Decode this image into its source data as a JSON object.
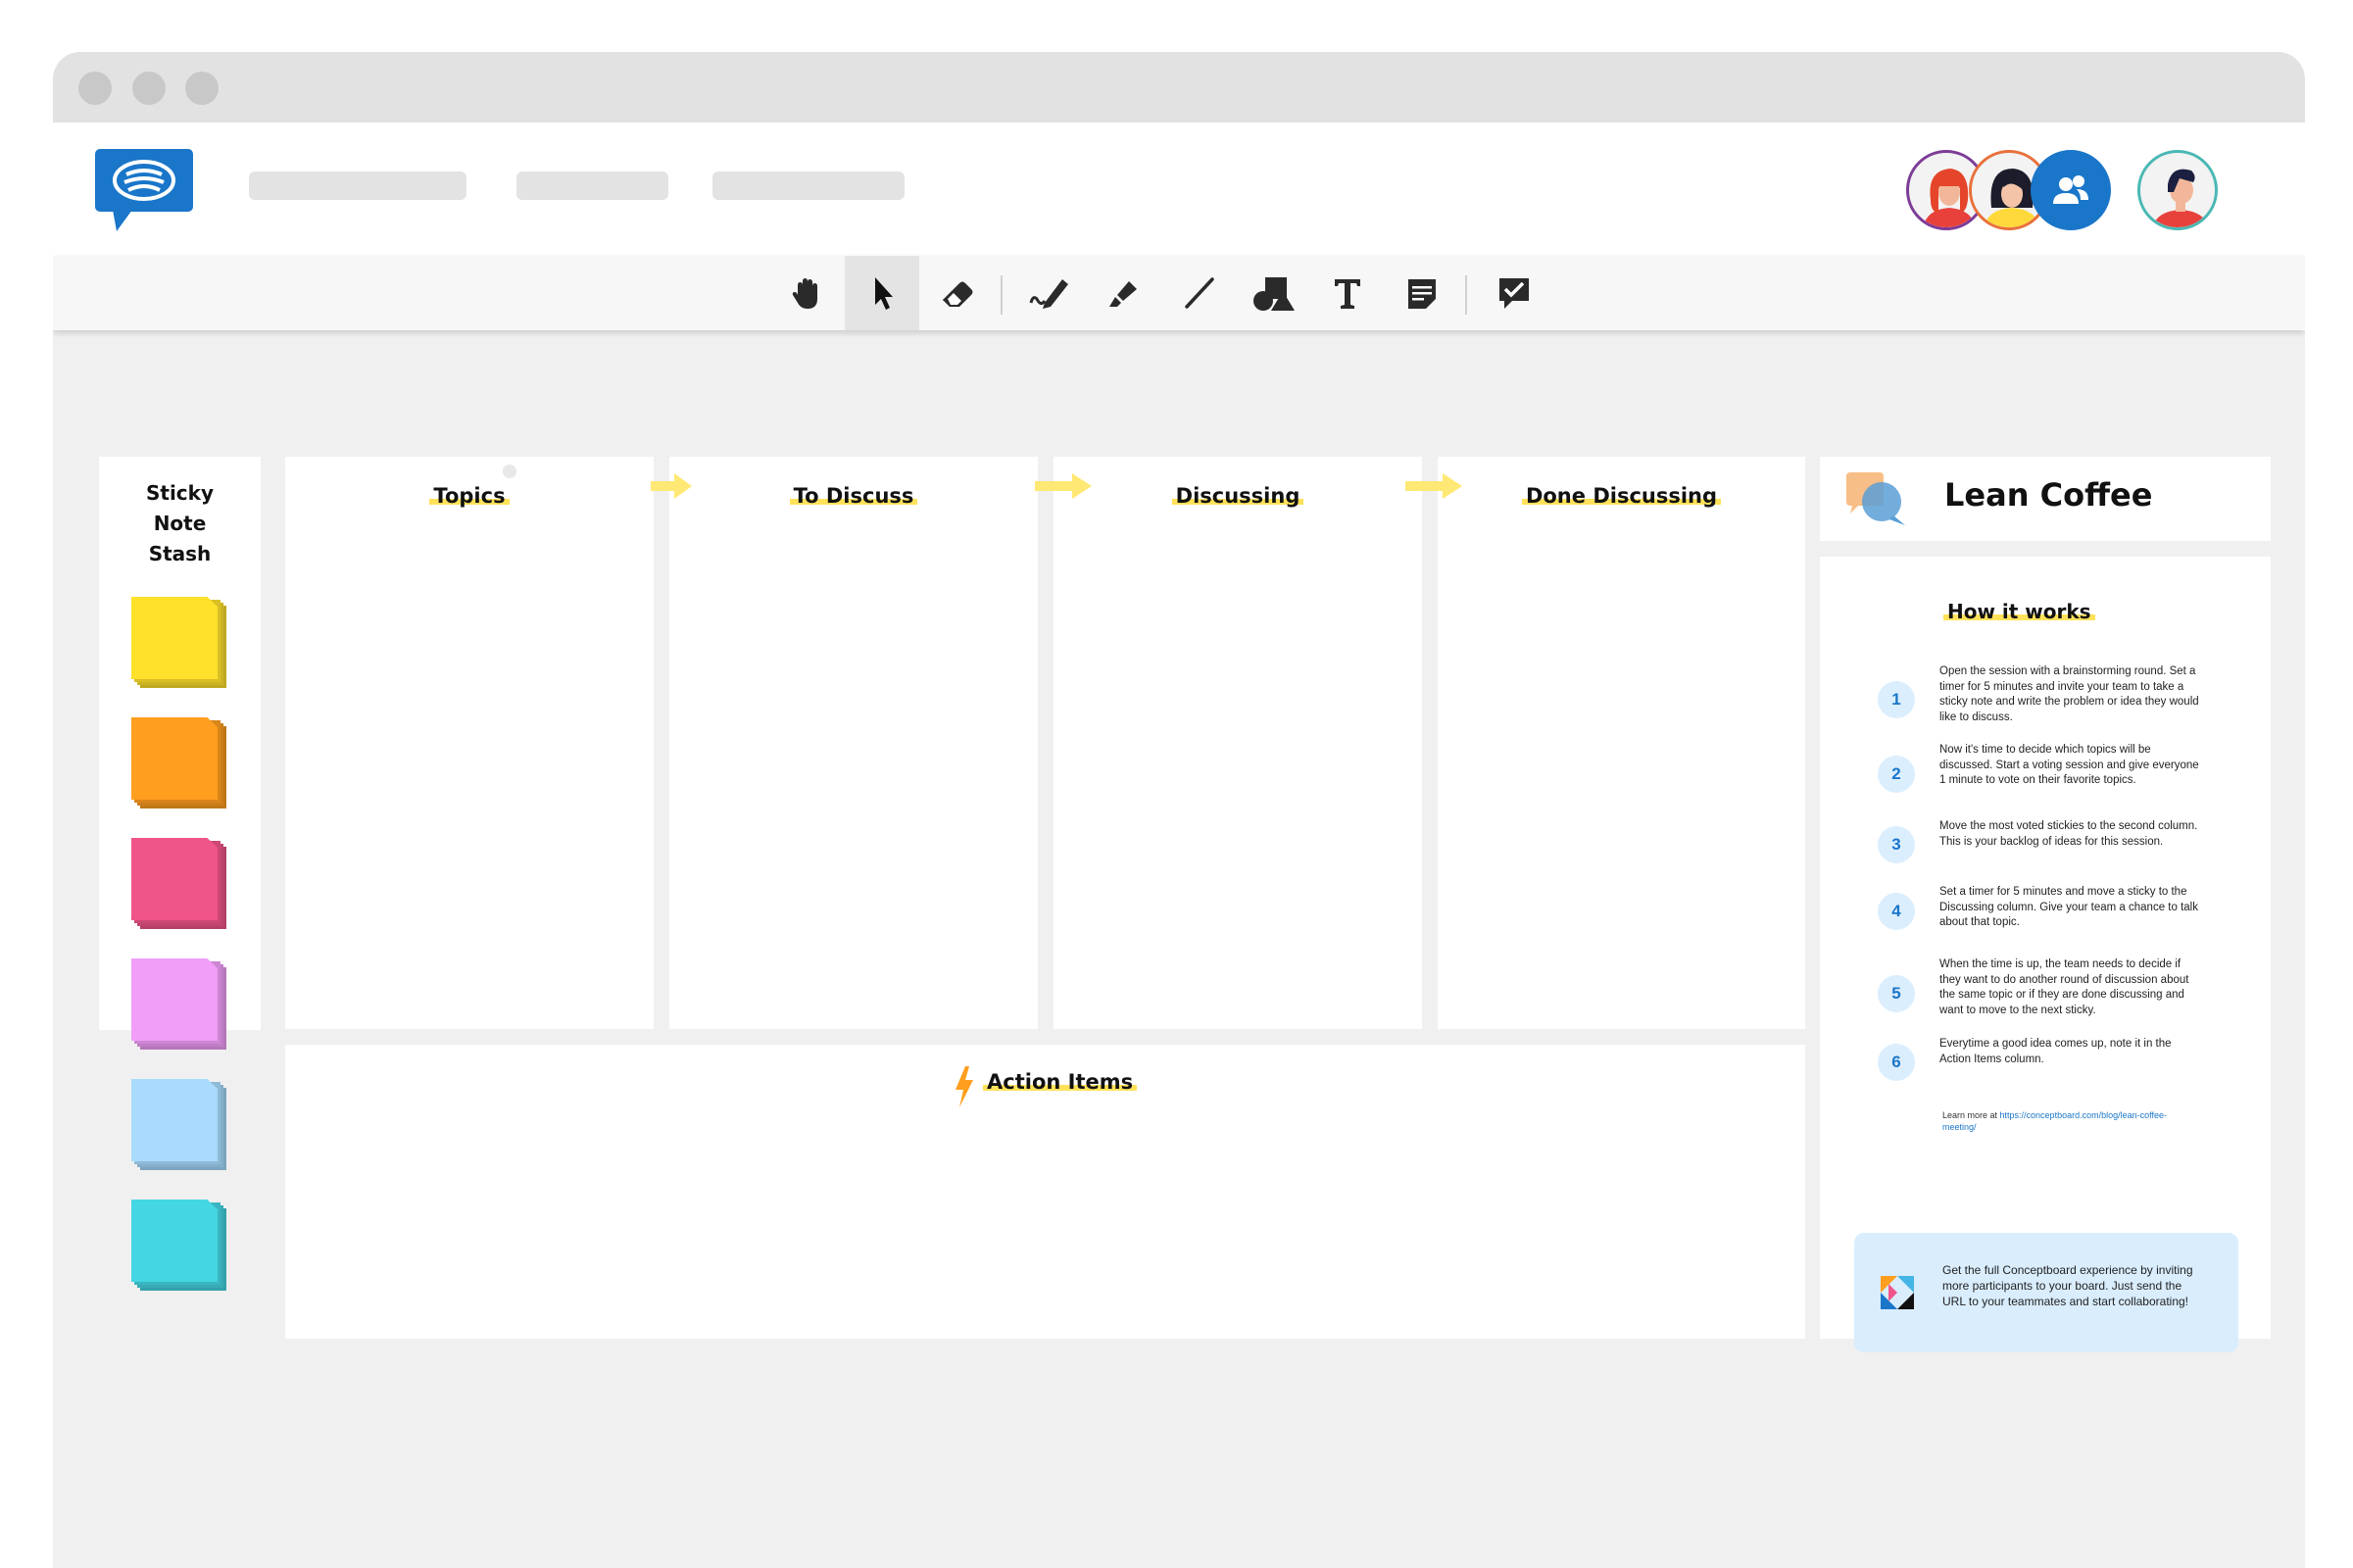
{
  "board": {
    "stash_title_lines": [
      "Sticky",
      "Note",
      "Stash"
    ],
    "columns": [
      {
        "label": "Topics"
      },
      {
        "label": "To Discuss"
      },
      {
        "label": "Discussing"
      },
      {
        "label": "Done Discussing"
      }
    ],
    "action_items_label": "Action Items",
    "sticky_colors": [
      "#ffe02b",
      "#ff9e1f",
      "#f0558a",
      "#f09ef7",
      "#a8dbfd",
      "#45d6e3"
    ]
  },
  "sidebar": {
    "title": "Lean Coffee",
    "how_it_works": "How it works",
    "steps": [
      {
        "num": "1",
        "text": "Open the session with a brainstorming round. Set a timer for 5 minutes and invite your team to take a sticky note and write the problem or idea they would like to discuss."
      },
      {
        "num": "2",
        "text": "Now it's time to decide which topics will be discussed. Start a voting session and give everyone 1 minute to vote on their favorite topics."
      },
      {
        "num": "3",
        "text": "Move the most voted stickies to the second column. This is your backlog of ideas for this session."
      },
      {
        "num": "4",
        "text": "Set a timer for 5 minutes and move a sticky to the Discussing column. Give your team a chance to talk about that topic."
      },
      {
        "num": "5",
        "text": "When the time is up, the team needs to decide if they want to do another round of discussion about the same topic or if they are done discussing and want to move to the next sticky."
      },
      {
        "num": "6",
        "text": "Everytime a good idea comes up, note it in the Action Items column."
      }
    ],
    "learn_more_prefix": "Learn more at ",
    "learn_more_link": "https://conceptboard.com/blog/lean-coffee-meeting/",
    "promo_text": "Get the full Conceptboard experience by inviting more participants to your board. Just send the URL to your teammates and start collaborating!"
  },
  "toolbar": {
    "tools": [
      "hand-icon",
      "pointer-icon",
      "eraser-icon",
      "pen-icon",
      "highlighter-icon",
      "line-icon",
      "shapes-icon",
      "text-icon",
      "sticky-note-icon",
      "feedback-icon"
    ],
    "active_tool": "pointer-icon"
  },
  "colors": {
    "accent_blue": "#1a76c9",
    "highlight_yellow": "#ffe25a",
    "canvas": "#f0f0f0"
  }
}
